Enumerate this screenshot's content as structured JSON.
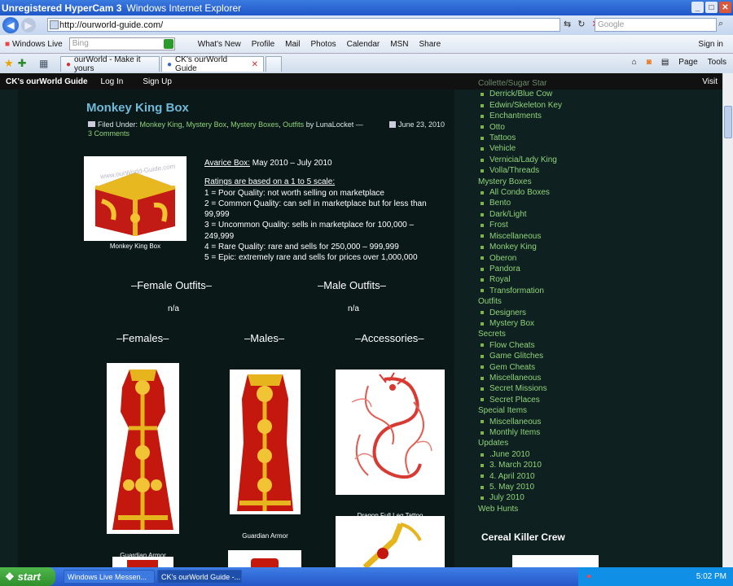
{
  "window": {
    "hypercam": "Unregistered HyperCam 3",
    "title": "Windows Internet Explorer",
    "min": "_",
    "max": "□",
    "close": "✕"
  },
  "address": {
    "url": "http://ourworld-guide.com/",
    "search_placeholder": "Google"
  },
  "links": {
    "windows_live": "Windows Live",
    "bing_placeholder": "Bing",
    "items": [
      "What's New",
      "Profile",
      "Mail",
      "Photos",
      "Calendar",
      "MSN",
      "Share"
    ],
    "signin": "Sign in"
  },
  "tabs": [
    {
      "label": "ourWorld - Make it yours"
    },
    {
      "label": "CK's ourWorld Guide"
    }
  ],
  "tab_tools": {
    "page": "Page",
    "tools": "Tools"
  },
  "site": {
    "brand": "CK's ourWorld Guide",
    "login": "Log In",
    "signup": "Sign Up",
    "visit": "Visit"
  },
  "post": {
    "title": "Monkey King Box",
    "filed_under": "Filed Under:",
    "cat1": "Monkey King",
    "cat2": "Mystery Box",
    "cat3": "Mystery Boxes",
    "cat4": "Outfits",
    "by": "by LunaLocket —",
    "comments": "3 Comments",
    "date": "June 23, 2010",
    "thumb_caption": "Monkey King Box",
    "thumb_watermark": "www.ourWorld-Guide.com",
    "avarice_label": "Avarice Box:",
    "avarice_value": "May 2010 – July 2010",
    "ratings_header": "Ratings are based on a 1 to 5 scale:",
    "ratings": [
      "1 = Poor Quality: not worth selling on marketplace",
      "2 = Common Quality: can sell in marketplace but for less than 99,999",
      "3 = Uncommon Quality: sells in marketplace for 100,000 – 249,999",
      "4 = Rare Quality: rare and sells for 250,000 – 999,999",
      "5 = Epic: extremely rare and sells for prices over 1,000,000"
    ],
    "female_outfits": "–Female Outfits–",
    "male_outfits": "–Male Outfits–",
    "female_na": "n/a",
    "male_na": "n/a",
    "females": "–Females–",
    "males": "–Males–",
    "accessories": "–Accessories–",
    "female_item": "Guardian Armor",
    "male_item": "Guardian Armor",
    "accessory_item": "Dragon Full Leg Tattoo"
  },
  "sidebar": {
    "items": [
      {
        "text": "Collette/Sugar Star",
        "kind": "dim"
      },
      {
        "text": "Derrick/Blue Cow",
        "kind": "sub"
      },
      {
        "text": "Edwin/Skeleton Key",
        "kind": "sub"
      },
      {
        "text": "Enchantments",
        "kind": "sub"
      },
      {
        "text": "Otto",
        "kind": "sub"
      },
      {
        "text": "Tattoos",
        "kind": "sub"
      },
      {
        "text": "Vehicle",
        "kind": "sub"
      },
      {
        "text": "Vernicia/Lady King",
        "kind": "sub"
      },
      {
        "text": "Volla/Threads",
        "kind": "sub"
      },
      {
        "text": "Mystery Boxes",
        "kind": "cat"
      },
      {
        "text": "All Condo Boxes",
        "kind": "sub"
      },
      {
        "text": "Bento",
        "kind": "sub"
      },
      {
        "text": "Dark/Light",
        "kind": "sub"
      },
      {
        "text": "Frost",
        "kind": "sub"
      },
      {
        "text": "Miscellaneous",
        "kind": "sub"
      },
      {
        "text": "Monkey King",
        "kind": "sub"
      },
      {
        "text": "Oberon",
        "kind": "sub"
      },
      {
        "text": "Pandora",
        "kind": "sub"
      },
      {
        "text": "Royal",
        "kind": "sub"
      },
      {
        "text": "Transformation",
        "kind": "sub"
      },
      {
        "text": "Outfits",
        "kind": "cat"
      },
      {
        "text": "Designers",
        "kind": "sub"
      },
      {
        "text": "Mystery Box",
        "kind": "sub"
      },
      {
        "text": "Secrets",
        "kind": "cat"
      },
      {
        "text": "Flow Cheats",
        "kind": "sub"
      },
      {
        "text": "Game Glitches",
        "kind": "sub"
      },
      {
        "text": "Gem Cheats",
        "kind": "sub"
      },
      {
        "text": "Miscellaneous",
        "kind": "sub"
      },
      {
        "text": "Secret Missions",
        "kind": "sub"
      },
      {
        "text": "Secret Places",
        "kind": "sub"
      },
      {
        "text": "Special Items",
        "kind": "cat"
      },
      {
        "text": "Miscellaneous",
        "kind": "sub"
      },
      {
        "text": "Monthly Items",
        "kind": "sub"
      },
      {
        "text": "Updates",
        "kind": "cat"
      },
      {
        "text": ".June 2010",
        "kind": "sub"
      },
      {
        "text": "3. March 2010",
        "kind": "sub"
      },
      {
        "text": "4. April 2010",
        "kind": "sub"
      },
      {
        "text": "5. May 2010",
        "kind": "sub"
      },
      {
        "text": "July 2010",
        "kind": "sub"
      },
      {
        "text": "Web Hunts",
        "kind": "cat"
      }
    ],
    "crew": "Cereal Killer Crew"
  },
  "taskbar": {
    "start": "start",
    "messenger": "Windows Live Messen...",
    "ie": "CK's ourWorld Guide -...",
    "time": "5:02 PM"
  }
}
